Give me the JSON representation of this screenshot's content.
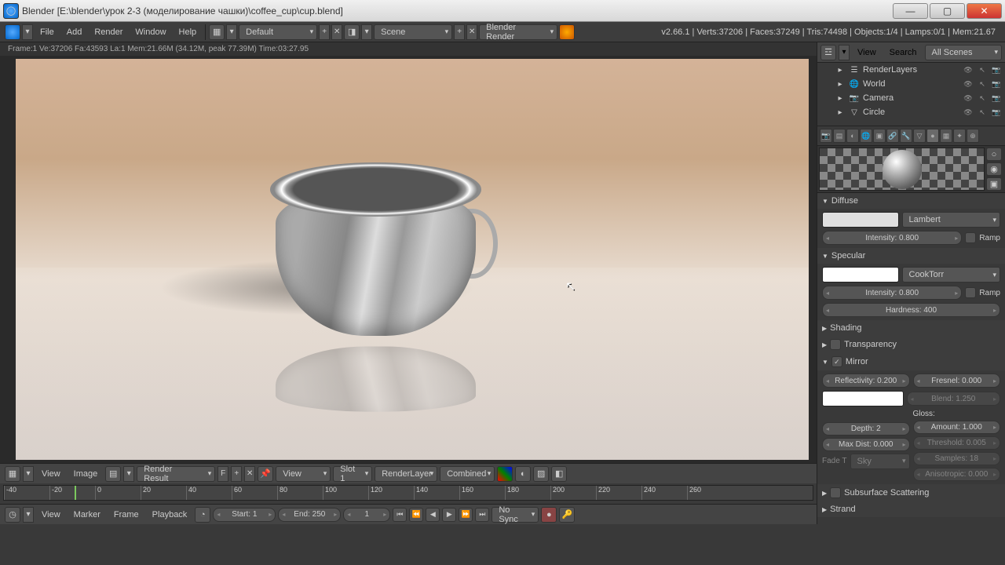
{
  "window": {
    "title": "Blender [E:\\blender\\урок 2-3 (моделирование чашки)\\coffee_cup\\cup.blend]"
  },
  "menubar": {
    "file": "File",
    "add": "Add",
    "render": "Render",
    "window": "Window",
    "help": "Help",
    "layout": "Default",
    "scene": "Scene",
    "engine": "Blender Render",
    "stats": "v2.66.1 | Verts:37206 | Faces:37249 | Tris:74498 | Objects:1/4 | Lamps:0/1 | Mem:21.67"
  },
  "render_info": "Frame:1 Ve:37206 Fa:43593 La:1 Mem:21.66M (34.12M, peak 77.39M) Time:03:27.95",
  "outliner": {
    "view": "View",
    "search": "Search",
    "filter": "All Scenes",
    "items": [
      {
        "name": "RenderLayers",
        "icon": "☰"
      },
      {
        "name": "World",
        "icon": "🌐"
      },
      {
        "name": "Camera",
        "icon": "📷"
      },
      {
        "name": "Circle",
        "icon": "▽"
      }
    ]
  },
  "material": {
    "diffuse": {
      "title": "Diffuse",
      "shader": "Lambert",
      "intensity": "Intensity: 0.800",
      "ramp": "Ramp"
    },
    "specular": {
      "title": "Specular",
      "shader": "CookTorr",
      "intensity": "Intensity: 0.800",
      "ramp": "Ramp",
      "hardness": "Hardness: 400"
    },
    "shading": {
      "title": "Shading"
    },
    "transparency": {
      "title": "Transparency"
    },
    "mirror": {
      "title": "Mirror",
      "reflectivity": "Reflectivity: 0.200",
      "fresnel": "Fresnel: 0.000",
      "blend": "Blend: 1.250",
      "depth": "Depth: 2",
      "maxdist": "Max Dist: 0.000",
      "fadeto": "Fade T",
      "sky": "Sky",
      "gloss": "Gloss:",
      "amount": "Amount: 1.000",
      "threshold": "Threshold: 0.005",
      "samples": "Samples: 18",
      "anisotropic": "Anisotropic: 0.000"
    },
    "sss": {
      "title": "Subsurface Scattering"
    },
    "strand": {
      "title": "Strand"
    }
  },
  "image_editor": {
    "view": "View",
    "image": "Image",
    "result": "Render Result",
    "f": "F",
    "viewmode": "View",
    "slot": "Slot 1",
    "layer": "RenderLayer",
    "pass": "Combined"
  },
  "timeline": {
    "view": "View",
    "marker": "Marker",
    "frame": "Frame",
    "playback": "Playback",
    "start": "Start: 1",
    "end": "End: 250",
    "current": "1",
    "sync": "No Sync",
    "marks": [
      "-40",
      "-20",
      "0",
      "20",
      "40",
      "60",
      "80",
      "100",
      "120",
      "140",
      "160",
      "180",
      "200",
      "220",
      "240",
      "260"
    ]
  }
}
